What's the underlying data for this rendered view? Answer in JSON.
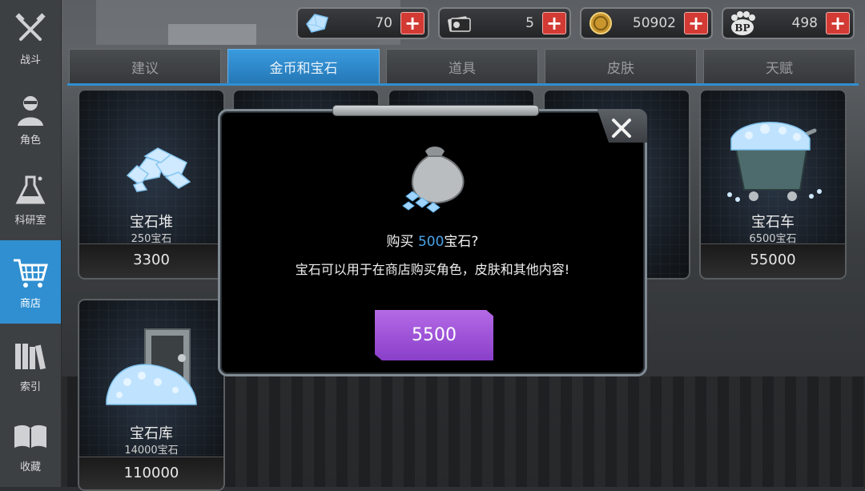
{
  "sidebar": {
    "items": [
      {
        "label": "战斗",
        "icon": "crossed-guns-icon"
      },
      {
        "label": "角色",
        "icon": "character-icon"
      },
      {
        "label": "科研室",
        "icon": "flask-icon"
      },
      {
        "label": "商店",
        "icon": "cart-icon",
        "active": true
      },
      {
        "label": "索引",
        "icon": "books-icon"
      },
      {
        "label": "收藏",
        "icon": "open-book-icon"
      }
    ]
  },
  "currency": {
    "gems": "70",
    "cards": "5",
    "coins": "50902",
    "bp": "498",
    "bp_icon_text": "BP"
  },
  "tabs": [
    {
      "label": "建议"
    },
    {
      "label": "金币和宝石",
      "active": true
    },
    {
      "label": "道具"
    },
    {
      "label": "皮肤"
    },
    {
      "label": "天赋"
    }
  ],
  "cards": [
    {
      "name": "宝石堆",
      "sub": "250宝石",
      "price": "3300"
    },
    {
      "name": "宝石车",
      "sub": "6500宝石",
      "price": "55000"
    },
    {
      "name": "宝石库",
      "sub": "14000宝石",
      "price": "110000"
    }
  ],
  "dialog": {
    "prefix": "购买 ",
    "amount": "500",
    "suffix": "宝石?",
    "description": "宝石可以用于在商店购买角色，皮肤和其他内容!",
    "buy_price": "5500",
    "close_symbol": "✕"
  },
  "colors": {
    "accent": "#2f8fd0",
    "buy": "#9b4fd6",
    "plus": "#d23a33"
  }
}
